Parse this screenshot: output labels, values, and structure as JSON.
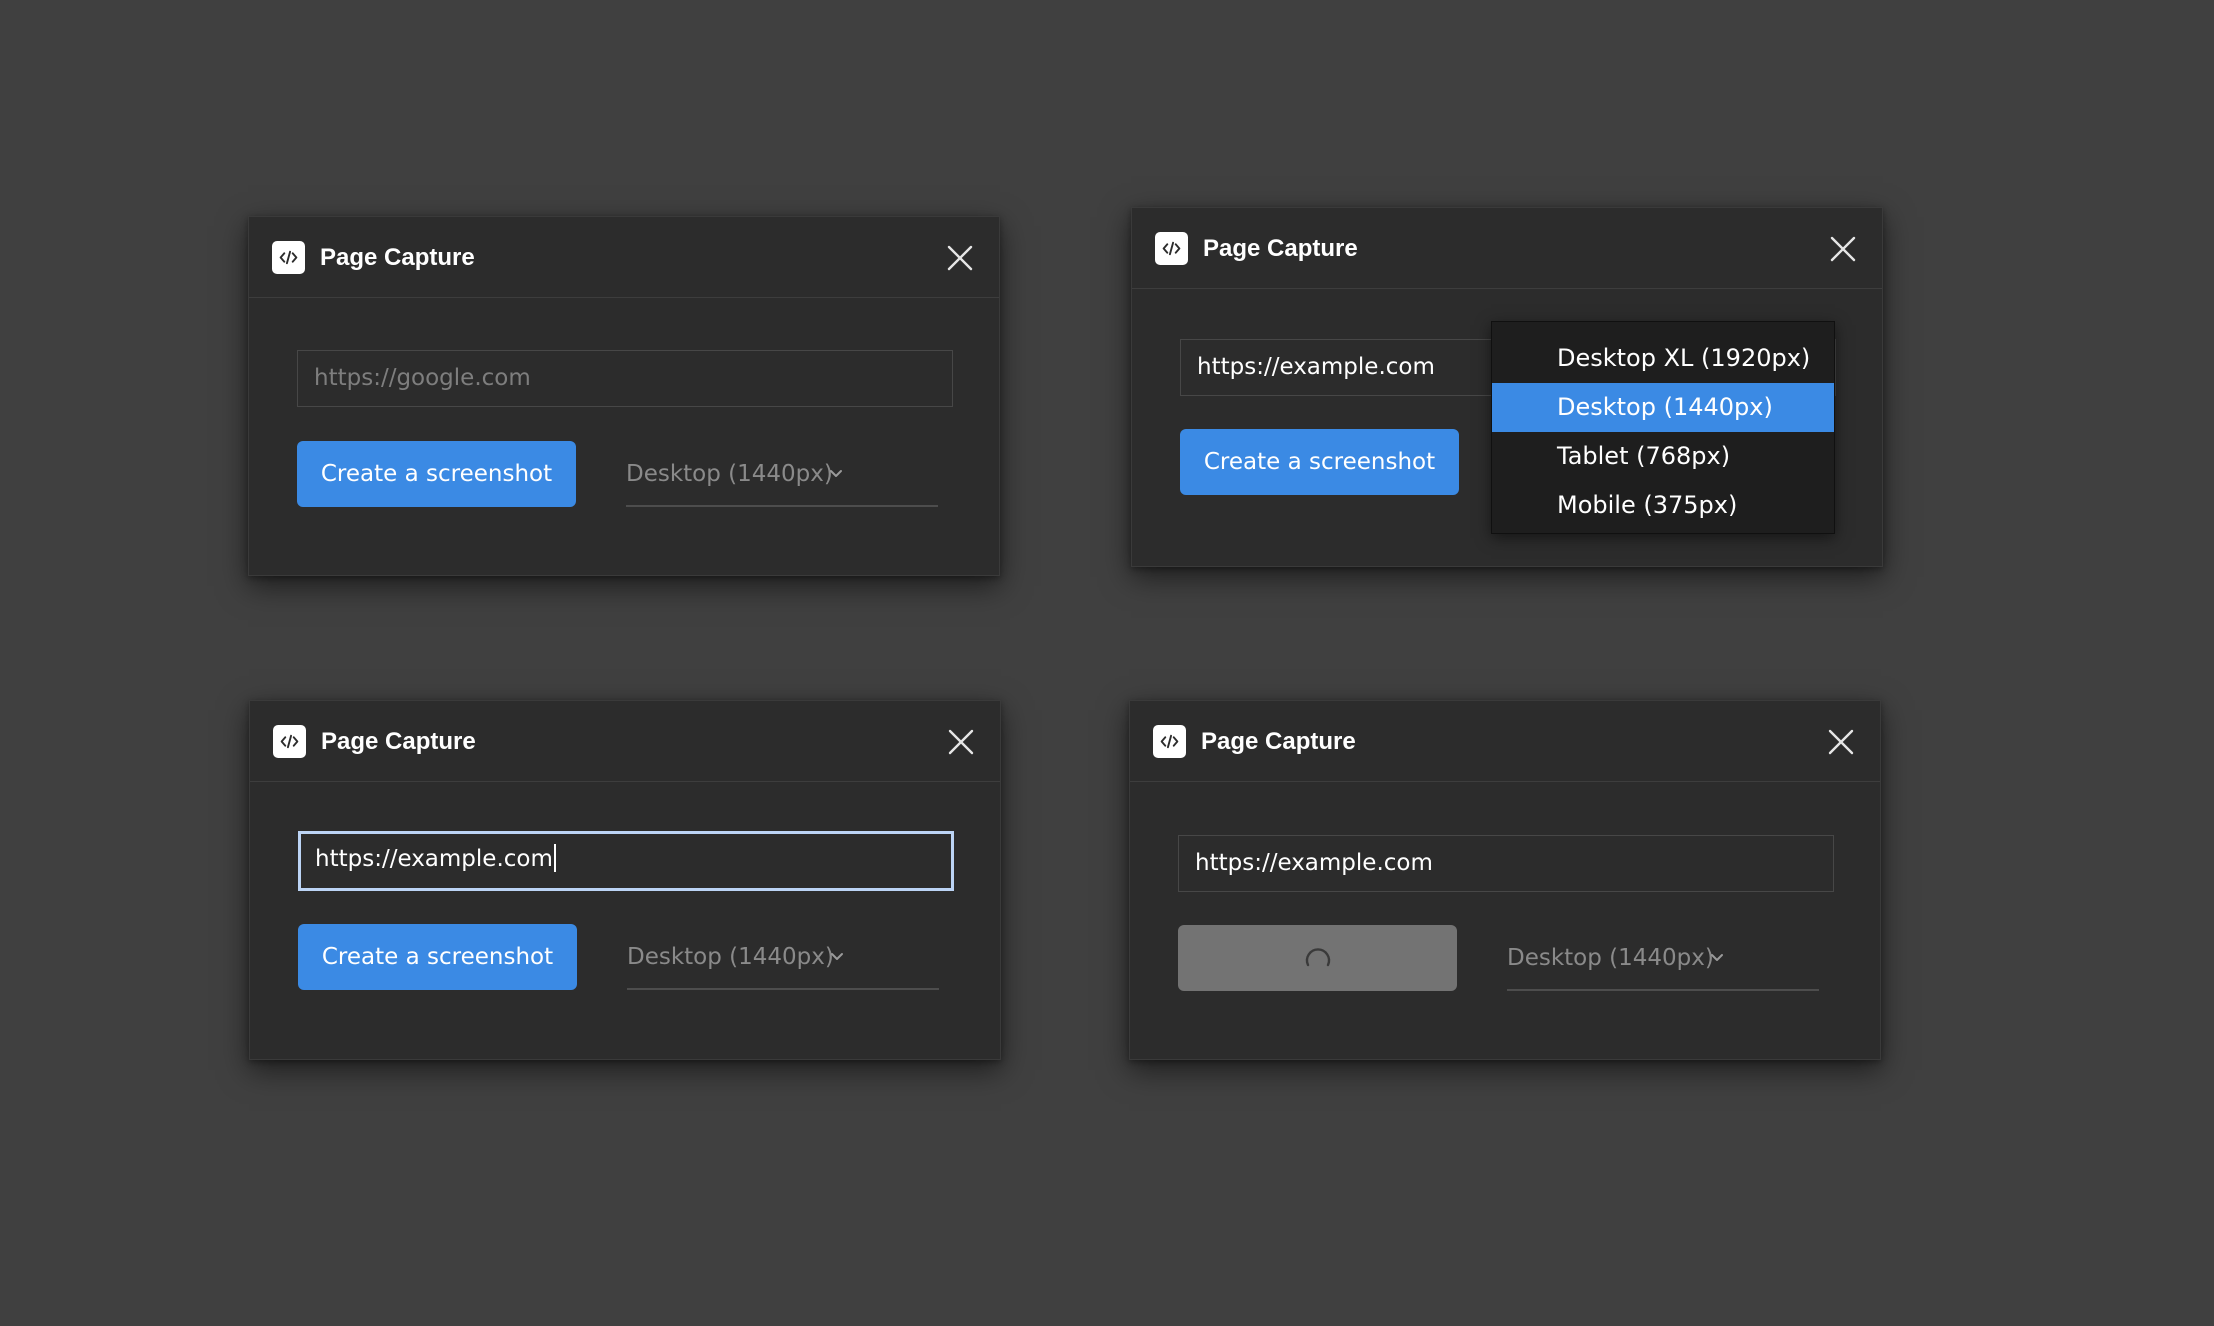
{
  "app": {
    "title": "Page Capture",
    "icon": "code-icon"
  },
  "colors": {
    "background": "#404040",
    "panel": "#2c2c2c",
    "accent": "#3b8ae4",
    "loading": "#737373",
    "dropdown": "#1e1e1e"
  },
  "panels": [
    {
      "state": "empty",
      "url_placeholder": "https://google.com",
      "button_label": "Create a screenshot",
      "viewport": "Desktop (1440px)"
    },
    {
      "state": "dropdown-open",
      "url_value": "https://example.com",
      "button_label": "Create a screenshot"
    },
    {
      "state": "focused",
      "url_value": "https://example.com",
      "button_label": "Create a screenshot",
      "viewport": "Desktop (1440px)"
    },
    {
      "state": "loading",
      "url_value": "https://example.com",
      "viewport": "Desktop (1440px)"
    }
  ],
  "viewport_options": [
    "Desktop XL (1920px)",
    "Desktop (1440px)",
    "Tablet (768px)",
    "Mobile (375px)"
  ],
  "selected_option": "Desktop (1440px)"
}
